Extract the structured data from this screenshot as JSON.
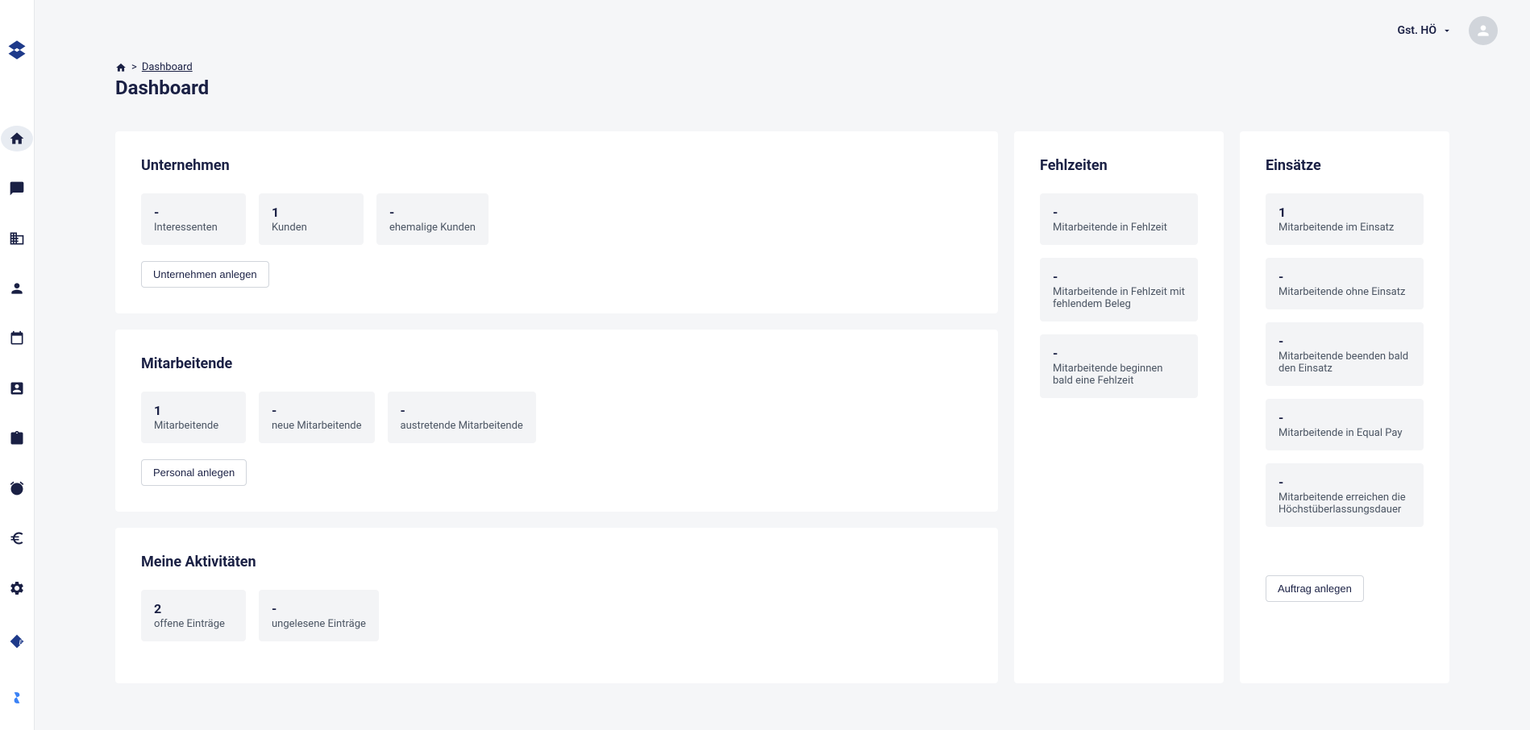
{
  "header": {
    "user_label": "Gst. HÖ"
  },
  "breadcrumb": {
    "link": "Dashboard"
  },
  "page": {
    "title": "Dashboard"
  },
  "unternehmen": {
    "title": "Unternehmen",
    "tiles": [
      {
        "value": "-",
        "label": "Interessenten"
      },
      {
        "value": "1",
        "label": "Kunden"
      },
      {
        "value": "-",
        "label": "ehemalige Kunden"
      }
    ],
    "create_button": "Unternehmen anlegen"
  },
  "mitarbeitende": {
    "title": "Mitarbeitende",
    "tiles": [
      {
        "value": "1",
        "label": "Mitarbeitende"
      },
      {
        "value": "-",
        "label": "neue Mitarbeitende"
      },
      {
        "value": "-",
        "label": "austretende Mitarbeitende"
      }
    ],
    "create_button": "Personal anlegen"
  },
  "aktivitaeten": {
    "title": "Meine Aktivitäten",
    "tiles": [
      {
        "value": "2",
        "label": "offene Einträge"
      },
      {
        "value": "-",
        "label": "ungelesene Einträge"
      }
    ]
  },
  "fehlzeiten": {
    "title": "Fehlzeiten",
    "tiles": [
      {
        "value": "-",
        "label": "Mitarbeitende in Fehlzeit"
      },
      {
        "value": "-",
        "label": "Mitarbeitende in Fehlzeit mit fehlendem Beleg"
      },
      {
        "value": "-",
        "label": "Mitarbeitende beginnen bald eine Fehlzeit"
      }
    ]
  },
  "einsaetze": {
    "title": "Einsätze",
    "tiles": [
      {
        "value": "1",
        "label": "Mitarbeitende im Einsatz"
      },
      {
        "value": "-",
        "label": "Mitarbeitende ohne Einsatz"
      },
      {
        "value": "-",
        "label": "Mitarbeitende beenden bald den Einsatz"
      },
      {
        "value": "-",
        "label": "Mitarbeitende in Equal Pay"
      },
      {
        "value": "-",
        "label": "Mitarbeitende erreichen die Höchstüberlassungsdauer"
      }
    ],
    "create_button": "Auftrag anlegen"
  }
}
